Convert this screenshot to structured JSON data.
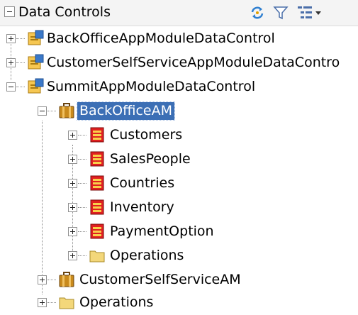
{
  "panel": {
    "title": "Data Controls",
    "toolbar": {
      "refresh_icon": "refresh-icon",
      "filter_icon": "filter-icon",
      "options_icon": "tree-options-icon"
    }
  },
  "tree": {
    "root_items": [
      {
        "label": "BackOfficeAppModuleDataControl",
        "icon": "data-control-icon",
        "expanded": false
      },
      {
        "label": "CustomerSelfServiceAppModuleDataContro",
        "icon": "data-control-icon",
        "expanded": false
      },
      {
        "label": "SummitAppModuleDataControl",
        "icon": "data-control-icon",
        "expanded": true,
        "children": [
          {
            "label": "BackOfficeAM",
            "icon": "app-module-icon",
            "expanded": true,
            "selected": true,
            "children": [
              {
                "label": "Customers",
                "icon": "collection-icon"
              },
              {
                "label": "SalesPeople",
                "icon": "collection-icon"
              },
              {
                "label": "Countries",
                "icon": "collection-icon"
              },
              {
                "label": "Inventory",
                "icon": "collection-icon"
              },
              {
                "label": "PaymentOption",
                "icon": "collection-icon"
              },
              {
                "label": "Operations",
                "icon": "folder-icon"
              }
            ]
          },
          {
            "label": "CustomerSelfServiceAM",
            "icon": "app-module-icon",
            "expanded": false
          },
          {
            "label": "Operations",
            "icon": "folder-icon",
            "expanded": false
          }
        ]
      }
    ]
  },
  "colors": {
    "selection": "#3c6fb5",
    "collection_red": "#e02020",
    "folder_yellow": "#f3d77a"
  }
}
